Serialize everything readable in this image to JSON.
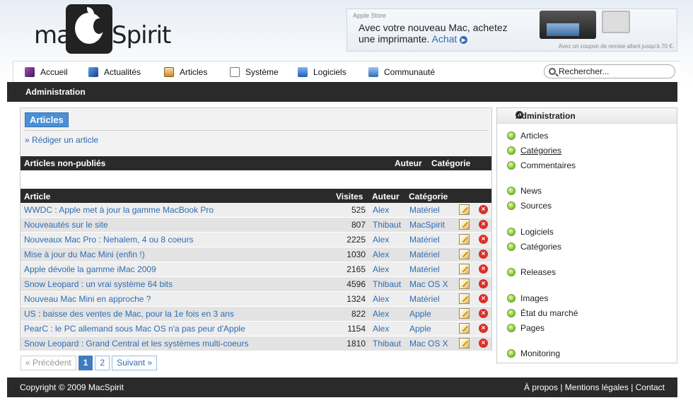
{
  "logo": {
    "pre": "ma",
    "post": "Spirit"
  },
  "ad": {
    "store": "Apple Store",
    "line1": "Avec votre nouveau Mac, achetez",
    "line2": "une imprimante.",
    "cta": "Achat",
    "small": "Avec un coupon de remise allant jusqu'à 70 €."
  },
  "nav": {
    "items": [
      {
        "label": "Accueil",
        "color": "#7a2b8a"
      },
      {
        "label": "Actualités",
        "color": "#2456a8"
      },
      {
        "label": "Articles",
        "color": "#c98a2a"
      },
      {
        "label": "Système",
        "color": "#333333"
      },
      {
        "label": "Logiciels",
        "color": "#2a6fc9"
      },
      {
        "label": "Communauté",
        "color": "#3f7fd0"
      }
    ],
    "search_placeholder": "Rechercher..."
  },
  "subnav": {
    "label": "Administration"
  },
  "main": {
    "tag": "Articles",
    "write_link": "» Rédiger un article",
    "unpublished": {
      "title": "Articles non-publiés",
      "author": "Auteur",
      "category": "Catégorie"
    },
    "columns": {
      "article": "Article",
      "visits": "Visites",
      "author": "Auteur",
      "category": "Catégorie"
    },
    "rows": [
      {
        "title": "WWDC : Apple met à jour la gamme MacBook Pro",
        "visits": "525",
        "author": "Alex",
        "category": "Matériel"
      },
      {
        "title": "Nouveautés sur le site",
        "visits": "807",
        "author": "Thibaut",
        "category": "MacSpirit"
      },
      {
        "title": "Nouveaux Mac Pro : Nehalem, 4 ou 8 coeurs",
        "visits": "2225",
        "author": "Alex",
        "category": "Matériel"
      },
      {
        "title": "Mise à jour du Mac Mini (enfin !)",
        "visits": "1030",
        "author": "Alex",
        "category": "Matériel"
      },
      {
        "title": "Apple dévoile la gamme iMac 2009",
        "visits": "2165",
        "author": "Alex",
        "category": "Matériel"
      },
      {
        "title": "Snow Leopard : un vrai système 64 bits",
        "visits": "4596",
        "author": "Thibaut",
        "category": "Mac OS X"
      },
      {
        "title": "Nouveau Mac Mini en approche ?",
        "visits": "1324",
        "author": "Alex",
        "category": "Matériel"
      },
      {
        "title": "US : baisse des ventes de Mac, pour la 1e fois en 3 ans",
        "visits": "822",
        "author": "Alex",
        "category": "Apple"
      },
      {
        "title": "PearC : le PC allemand sous Mac OS n'a pas peur d'Apple",
        "visits": "1154",
        "author": "Alex",
        "category": "Apple"
      },
      {
        "title": "Snow Leopard : Grand Central et les systèmes multi-coeurs",
        "visits": "1810",
        "author": "Thibaut",
        "category": "Mac OS X"
      }
    ],
    "pager": {
      "prev": "« Précédent",
      "page1": "1",
      "page2": "2",
      "next": "Suivant »"
    }
  },
  "sidebar": {
    "title": "Administration",
    "items": [
      {
        "label": "Articles"
      },
      {
        "label": "Catégories"
      },
      {
        "label": "Commentaires"
      },
      {
        "label": "News"
      },
      {
        "label": "Sources"
      },
      {
        "label": "Logiciels"
      },
      {
        "label": "Catégories"
      },
      {
        "label": "Releases"
      },
      {
        "label": "Images"
      },
      {
        "label": "État du marché"
      },
      {
        "label": "Pages"
      },
      {
        "label": "Monitoring"
      }
    ]
  },
  "footer": {
    "copyright": "Copyright © 2009 MacSpirit",
    "about": "À propos",
    "legal": "Mentions légales",
    "contact": "Contact"
  }
}
